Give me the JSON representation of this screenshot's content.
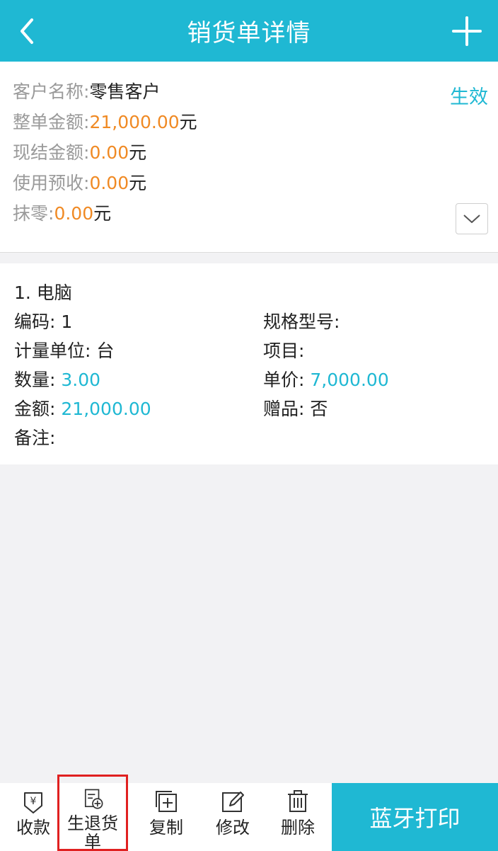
{
  "header": {
    "title": "销货单详情",
    "back_icon": "chevron-left-icon",
    "add_icon": "plus-icon",
    "color": "#1fb8d3"
  },
  "summary": {
    "status": "生效",
    "customer_label": "客户名称:",
    "customer_value": "零售客户",
    "total_label": "整单金额:",
    "total_value": "21,000.00",
    "total_unit": "元",
    "cash_label": "现结金额:",
    "cash_value": "0.00",
    "cash_unit": "元",
    "prepaid_label": "使用预收:",
    "prepaid_value": "0.00",
    "prepaid_unit": "元",
    "rounding_label": "抹零:",
    "rounding_value": "0.00",
    "rounding_unit": "元",
    "expand_icon": "chevron-down-icon"
  },
  "item": {
    "title": "1. 电脑",
    "code_label": "编码:",
    "code_value": "1",
    "spec_label": "规格型号:",
    "spec_value": "",
    "unit_label": "计量单位:",
    "unit_value": "台",
    "project_label": "项目:",
    "project_value": "",
    "qty_label": "数量:",
    "qty_value": "3.00",
    "price_label": "单价:",
    "price_value": "7,000.00",
    "amount_label": "金额:",
    "amount_value": "21,000.00",
    "gift_label": "赠品:",
    "gift_value": "否",
    "note_label": "备注:",
    "note_value": ""
  },
  "toolbar": {
    "collect": "收款",
    "return_line1": "生退货",
    "return_line2": "单",
    "copy": "复制",
    "edit": "修改",
    "delete": "删除",
    "print": "蓝牙打印"
  },
  "colors": {
    "accent": "#1fb8d3",
    "amount": "#f08a24",
    "highlight": "#e02020"
  }
}
